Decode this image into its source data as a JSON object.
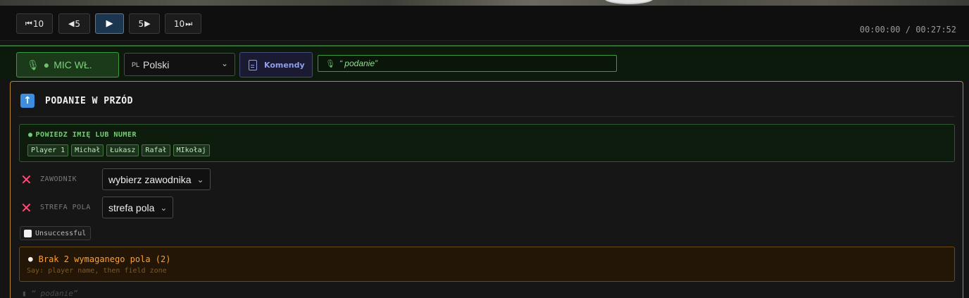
{
  "controls": {
    "back10": "10",
    "back5": "5",
    "play_icon": "play-icon",
    "fwd5": "5",
    "fwd10": "10",
    "time": "00:00:00 / 00:27:52"
  },
  "voice_bar": {
    "mic_label": "MIC WŁ.",
    "language_code": "PL",
    "language_value": "Polski",
    "commands_label": "Komendy",
    "transcript": "“ podanie”"
  },
  "panel": {
    "title": "PODANIE W PRZÓD",
    "hint": {
      "title": "POWIEDZ IMIĘ LUB NUMER",
      "players": [
        "Player 1",
        "Michał",
        "Łukasz",
        "Rafał",
        "MIkołaj"
      ]
    },
    "fields": [
      {
        "label": "ZAWODNIK",
        "value": "wybierz zawodnika"
      },
      {
        "label": "STREFA POLA",
        "value": "strefa pola"
      }
    ],
    "unsuccessful_label": "Unsuccessful",
    "warning": {
      "title": "Brak 2 wymaganego pola (2)",
      "subtitle": "Say: player name, then field zone"
    },
    "footer_transcript": "“ podanie”"
  },
  "colors": {
    "accent_blue": "#3b8ee0",
    "mic_green": "#3f9a3f",
    "panel_border": "#b8862a",
    "error_pink": "#ff4d7a",
    "warning_orange": "#ff9f2a"
  }
}
